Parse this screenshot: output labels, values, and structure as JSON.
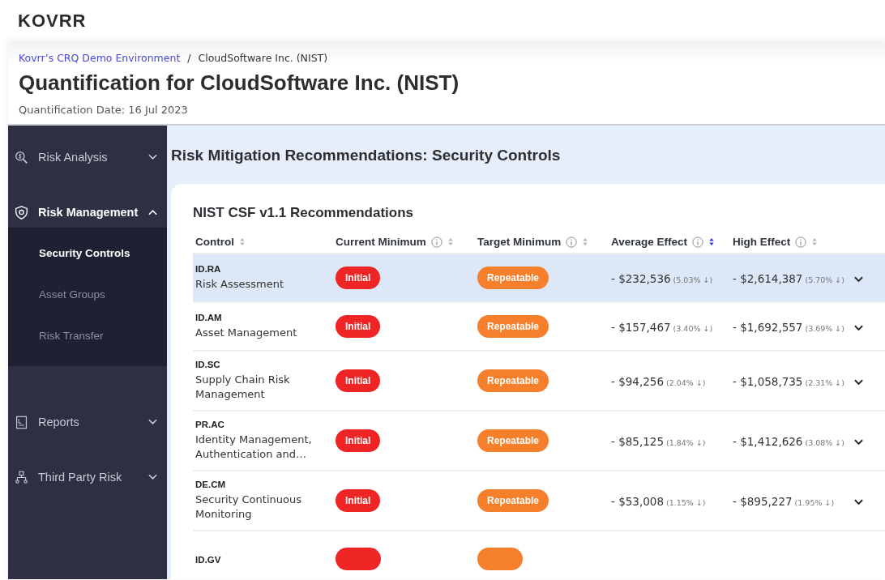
{
  "logo": "KOVRR",
  "breadcrumb": [
    {
      "label": "Kovrr’s CRQ Demo Environment",
      "link": true
    },
    {
      "label": "CloudSoftware Inc. (NIST)",
      "link": false
    }
  ],
  "breadcrumb_separator": "/",
  "title": "Quantification for CloudSoftware Inc. (NIST)",
  "date": "Quantification Date: 16 Jul 2023",
  "sidebar": {
    "items": [
      {
        "label": "Risk Analysis",
        "kind": "analysis",
        "expanded": false,
        "selected": false
      },
      {
        "label": "Risk Management",
        "kind": "management",
        "expanded": true,
        "selected": true,
        "children": [
          {
            "label": "Security Controls",
            "selected": true
          },
          {
            "label": "Asset Groups",
            "selected": false
          },
          {
            "label": "Risk Transfer",
            "selected": false
          }
        ]
      },
      {
        "label": "Reports",
        "kind": "reports",
        "expanded": false,
        "selected": false
      },
      {
        "label": "Third Party Risk",
        "kind": "thirdparty",
        "expanded": false,
        "selected": false
      }
    ]
  },
  "section_title": "Risk Mitigation Recommendations: Security Controls",
  "card": {
    "title": "NIST CSF v1.1 Recommendations",
    "columns": [
      {
        "label": "Control",
        "info": false,
        "sorted": false
      },
      {
        "label": "Current Minimum",
        "info": true,
        "sorted": false
      },
      {
        "label": "Target Minimum",
        "info": true,
        "sorted": false
      },
      {
        "label": "Average Effect",
        "info": true,
        "sorted": true
      },
      {
        "label": "High Effect",
        "info": true,
        "sorted": false
      }
    ],
    "rows": [
      {
        "code": "ID.RA",
        "name": "Risk Assessment",
        "current": {
          "label": "Initial",
          "kind": "initial"
        },
        "target": {
          "label": "Repeatable",
          "kind": "repeatable"
        },
        "avg": "- $232,536",
        "avg_pct": "(5.03% ↓)",
        "high": "- $2,614,387",
        "high_pct": "(5.70% ↓)",
        "selected": true
      },
      {
        "code": "ID.AM",
        "name": "Asset Management",
        "current": {
          "label": "Initial",
          "kind": "initial"
        },
        "target": {
          "label": "Repeatable",
          "kind": "repeatable"
        },
        "avg": "- $157,467",
        "avg_pct": "(3.40% ↓)",
        "high": "- $1,692,557",
        "high_pct": "(3.69% ↓)",
        "selected": false
      },
      {
        "code": "ID.SC",
        "name": "Supply Chain Risk Management",
        "current": {
          "label": "Initial",
          "kind": "initial"
        },
        "target": {
          "label": "Repeatable",
          "kind": "repeatable"
        },
        "avg": "- $94,256",
        "avg_pct": "(2.04% ↓)",
        "high": "- $1,058,735",
        "high_pct": "(2.31% ↓)",
        "selected": false
      },
      {
        "code": "PR.AC",
        "name": "Identity Management, Authentication and…",
        "current": {
          "label": "Initial",
          "kind": "initial"
        },
        "target": {
          "label": "Repeatable",
          "kind": "repeatable"
        },
        "avg": "- $85,125",
        "avg_pct": "(1.84% ↓)",
        "high": "- $1,412,626",
        "high_pct": "(3.08% ↓)",
        "selected": false
      },
      {
        "code": "DE.CM",
        "name": "Security Continuous Monitoring",
        "current": {
          "label": "Initial",
          "kind": "initial"
        },
        "target": {
          "label": "Repeatable",
          "kind": "repeatable"
        },
        "avg": "- $53,008",
        "avg_pct": "(1.15% ↓)",
        "high": "- $895,227",
        "high_pct": "(1.95% ↓)",
        "selected": false
      },
      {
        "code": "ID.GV",
        "selected": false
      }
    ]
  }
}
